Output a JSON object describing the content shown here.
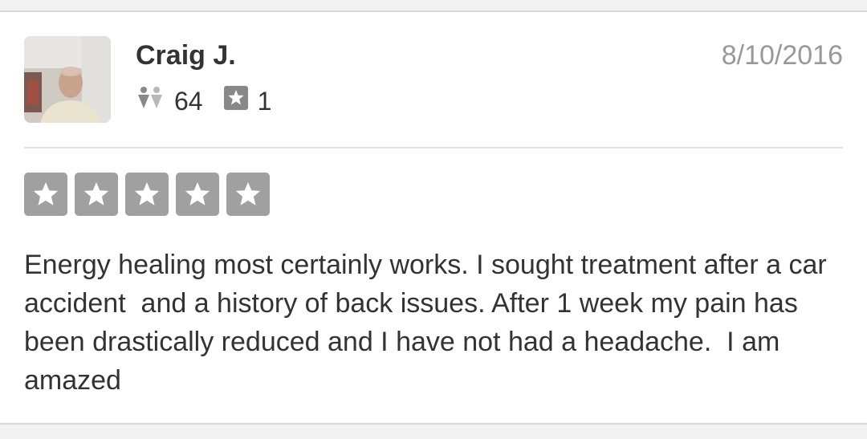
{
  "review": {
    "user": {
      "name": "Craig J.",
      "avatar_icon": "user-photo",
      "friends_count": "64",
      "friends_icon": "friends-icon",
      "reviews_count": "1",
      "reviews_icon": "review-star-icon"
    },
    "date": "8/10/2016",
    "rating": {
      "stars": 5,
      "max": 5,
      "star_color": "#a0a0a0"
    },
    "text": "Energy healing most certainly works. I sought treatment after a car accident  and a history of back issues. After 1 week my pain has been drastically reduced and I have not had a headache.  I am amazed"
  }
}
